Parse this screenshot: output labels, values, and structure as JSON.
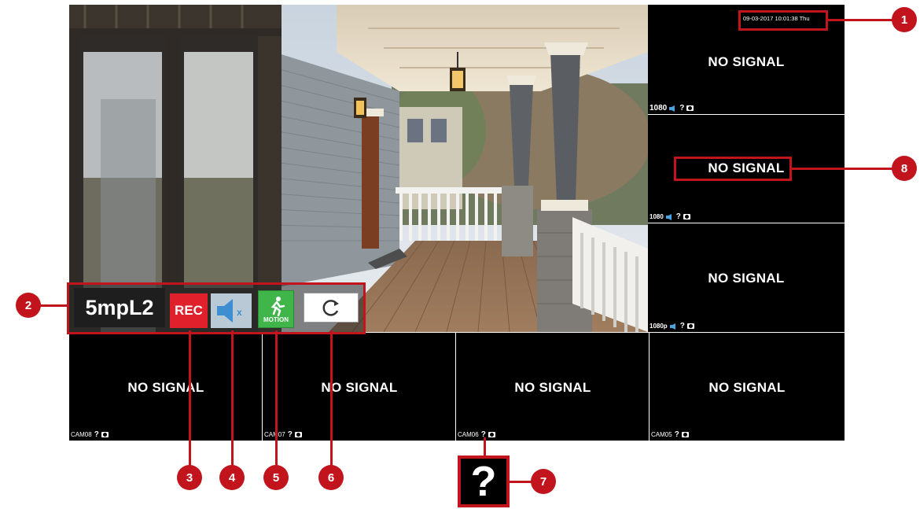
{
  "datetime": "09-03-2017 10:01:38 Thu",
  "no_signal_text": "NO SIGNAL",
  "toolbar": {
    "channel_name": "5mpL2",
    "rec_label": "REC",
    "motion_label": "MOTION"
  },
  "right_tiles": [
    {
      "res": "1080"
    },
    {
      "res": "1080"
    },
    {
      "res": "1080p"
    }
  ],
  "bottom_tiles": [
    {
      "cam": "CAM08"
    },
    {
      "cam": "CAM07"
    },
    {
      "cam": "CAM06"
    },
    {
      "cam": "CAM05"
    }
  ],
  "callouts": [
    "1",
    "2",
    "3",
    "4",
    "5",
    "6",
    "7",
    "8"
  ],
  "large_icon_symbol": "?",
  "colors": {
    "accent": "#c1141d",
    "rec": "#e0202a",
    "motion": "#3fb54a"
  }
}
